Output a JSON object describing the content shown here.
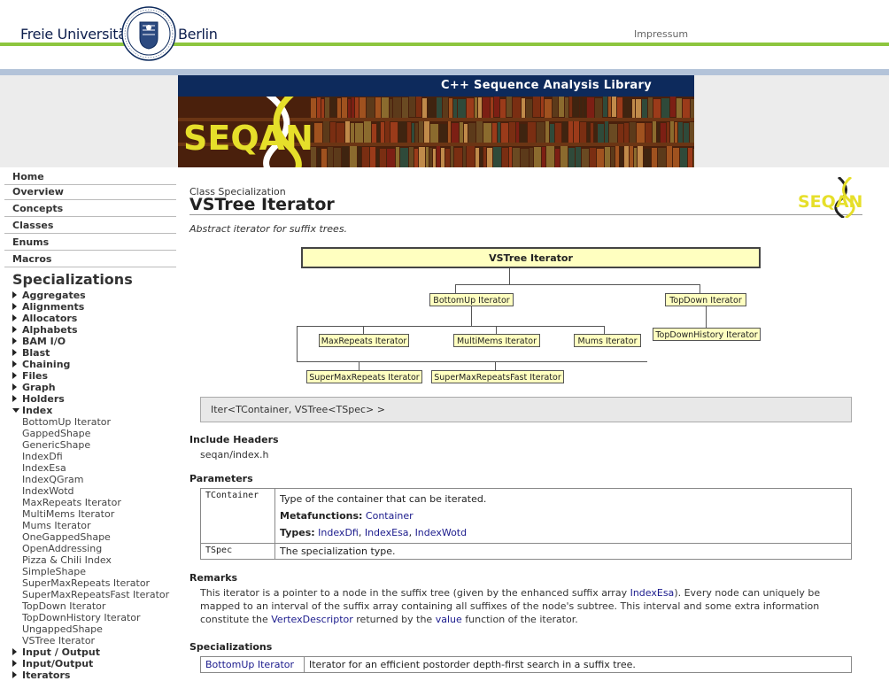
{
  "fu": {
    "name_left": "Freie Universität",
    "name_right": "Berlin",
    "impressum": "Impressum",
    "green": "#8dc63f"
  },
  "banner": {
    "title": "C++ Sequence Analysis Library",
    "logo_text": "SEQAN"
  },
  "sidebar": {
    "main": [
      "Home",
      "Overview",
      "Concepts",
      "Classes",
      "Enums",
      "Macros"
    ],
    "spec_title": "Specializations",
    "groups_before": [
      "Aggregates",
      "Alignments",
      "Allocators",
      "Alphabets",
      "BAM I/O",
      "Blast",
      "Chaining",
      "Files",
      "Graph",
      "Holders"
    ],
    "open_group": "Index",
    "index_items": [
      "BottomUp Iterator",
      "GappedShape",
      "GenericShape",
      "IndexDfi",
      "IndexEsa",
      "IndexQGram",
      "IndexWotd",
      "MaxRepeats Iterator",
      "MultiMems Iterator",
      "Mums Iterator",
      "OneGappedShape",
      "OpenAddressing",
      "Pizza & Chili Index",
      "SimpleShape",
      "SuperMaxRepeats Iterator",
      "SuperMaxRepeatsFast Iterator",
      "TopDown Iterator",
      "TopDownHistory Iterator",
      "UngappedShape",
      "VSTree Iterator"
    ],
    "groups_after": [
      "Input / Output",
      "Input/Output",
      "Iterators"
    ]
  },
  "page": {
    "kind": "Class Specialization",
    "title": "VSTree Iterator",
    "description": "Abstract iterator for suffix trees.",
    "signature": "Iter<TContainer, VSTree<TSpec> >"
  },
  "diagram": {
    "main": "VSTree Iterator",
    "bottomup": "BottomUp Iterator",
    "topdown": "TopDown Iterator",
    "maxrepeats": "MaxRepeats Iterator",
    "multimems": "MultiMems Iterator",
    "mums": "Mums Iterator",
    "topdownhistory": "TopDownHistory Iterator",
    "supermax": "SuperMaxRepeats Iterator",
    "supermaxfast": "SuperMaxRepeatsFast Iterator"
  },
  "include": {
    "heading": "Include Headers",
    "file": "seqan/index.h"
  },
  "params": {
    "heading": "Parameters",
    "rows": [
      {
        "name": "TContainer",
        "desc": "Type of the container that can be iterated.",
        "meta_label": "Metafunctions:",
        "meta_link": "Container",
        "types_label": "Types:",
        "types": [
          "IndexDfi",
          "IndexEsa",
          "IndexWotd"
        ]
      },
      {
        "name": "TSpec",
        "desc": "The specialization type."
      }
    ]
  },
  "remarks": {
    "heading": "Remarks",
    "t1": "This iterator is a pointer to a node in the suffix tree (given by the enhanced suffix array ",
    "l1": "IndexEsa",
    "t2": "). Every node can uniquely be mapped to an interval of the suffix array containing all suffixes of the node's subtree. This interval and some extra information constitute the ",
    "l2": "VertexDescriptor",
    "t3": " returned by the ",
    "l3": "value",
    "t4": " function of the iterator."
  },
  "specializations": {
    "heading": "Specializations",
    "rows": [
      {
        "name": "BottomUp Iterator",
        "desc": "Iterator for an efficient postorder depth-first search in a suffix tree."
      }
    ]
  }
}
